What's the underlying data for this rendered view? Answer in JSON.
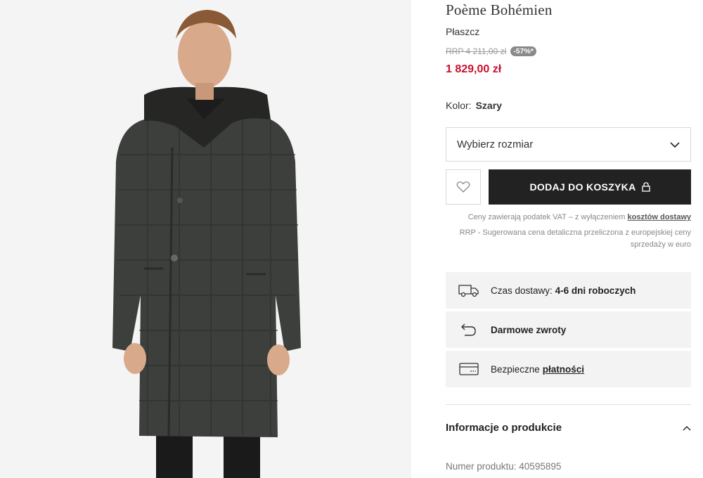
{
  "product": {
    "brand": "Poème Bohémien",
    "type": "Płaszcz",
    "rrp": "RRP 4 211,00 zł",
    "discount": "-57%*",
    "price": "1 829,00 zł",
    "color_label": "Kolor:",
    "color_value": "Szary"
  },
  "size_select": {
    "placeholder": "Wybierz rozmiar",
    "icon": "chevron-down-icon"
  },
  "actions": {
    "wishlist_icon": "heart-icon",
    "add_to_cart": "DODAJ DO KOSZYKA",
    "cart_icon": "bag-icon"
  },
  "notes": {
    "vat_text": "Ceny zawierają podatek VAT – z wyłączeniem",
    "vat_link": "kosztów dostawy",
    "rrp_line1": "RRP - Sugerowana cena detaliczna przeliczona z europejskiej ceny",
    "rrp_line2": "sprzedaży w euro"
  },
  "features": {
    "delivery_label": "Czas dostawy:",
    "delivery_value": "4-6 dni roboczych",
    "returns": "Darmowe zwroty",
    "payments_label": "Bezpieczne",
    "payments_link": "płatności"
  },
  "accordion": {
    "title": "Informacje o produkcie",
    "icon": "chevron-up-icon",
    "product_number": "Numer produktu: 40595895"
  },
  "colors": {
    "price": "#c8102e",
    "button_bg": "#222222",
    "feature_bg": "#f3f3f3"
  }
}
